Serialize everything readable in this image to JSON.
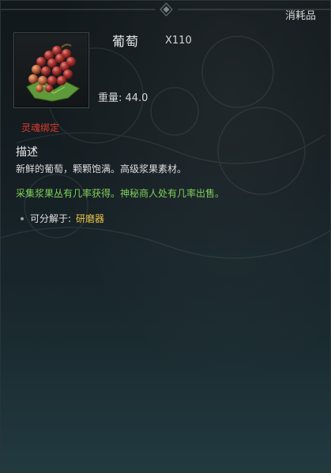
{
  "item": {
    "category": "消耗品",
    "name": "葡萄",
    "quantity": "X110",
    "weight_label": "重量: 44.0",
    "binding": "灵魂绑定",
    "icon": "grape-cluster-icon"
  },
  "description": {
    "title": "描述",
    "text": "新鲜的葡萄，颗颗饱满。高级浆果素材。"
  },
  "acquisition": {
    "text": "采集浆果丛有几率获得。神秘商人处有几率出售。"
  },
  "salvage": {
    "label": "可分解于:",
    "value": "研磨器"
  },
  "colors": {
    "binding": "#e03a2f",
    "acquisition": "#7fcf5a",
    "salvage_value": "#e9c44a",
    "background": "#151e22"
  }
}
